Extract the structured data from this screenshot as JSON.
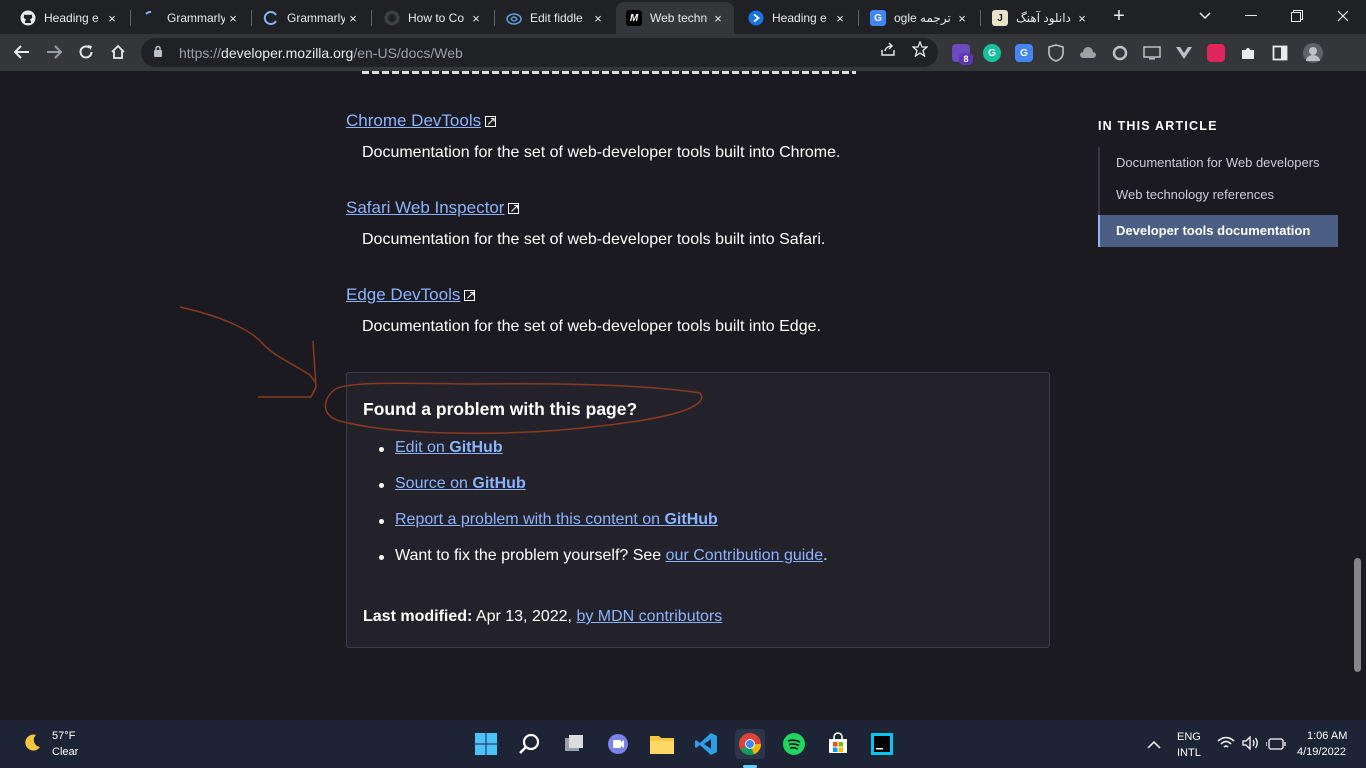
{
  "browser": {
    "tabs": [
      {
        "title": "Heading e",
        "icon": "github-icon"
      },
      {
        "title": "Grammarly",
        "icon": "loading-icon"
      },
      {
        "title": "Grammarly",
        "icon": "loading-icon"
      },
      {
        "title": "How to Co",
        "icon": "github-icon"
      },
      {
        "title": "Edit fiddle",
        "icon": "jsfiddle-icon"
      },
      {
        "title": "Web techn",
        "icon": "mdn-icon"
      },
      {
        "title": "Heading e",
        "icon": "blue-circle-icon"
      },
      {
        "title": "ogle ترجمه",
        "icon": "google-translate-icon"
      },
      {
        "title": "دانلود آهنگ",
        "icon": "site-icon"
      }
    ],
    "close_glyph": "×",
    "new_tab_glyph": "+",
    "url_host": "developer.mozilla.org",
    "url_prefix": "https://",
    "url_path": "/en-US/docs/Web",
    "ext_badge": "8"
  },
  "page": {
    "devtools": [
      {
        "name": "Chrome DevTools",
        "desc": "Documentation for the set of web-developer tools built into Chrome."
      },
      {
        "name": "Safari Web Inspector",
        "desc": "Documentation for the set of web-developer tools built into Safari."
      },
      {
        "name": "Edge DevTools",
        "desc": "Documentation for the set of web-developer tools built into Edge."
      }
    ],
    "toc_title": "IN THIS ARTICLE",
    "toc": [
      {
        "label": "Documentation for Web developers"
      },
      {
        "label": "Web technology references"
      },
      {
        "label": "Developer tools documentation"
      }
    ],
    "found": {
      "title": "Found a problem with this page?",
      "edit_prefix": "Edit on ",
      "source_prefix": "Source on ",
      "report_prefix": "Report a problem with this content on ",
      "github": "GitHub",
      "fix_text": "Want to fix the problem yourself? See ",
      "guide": "our Contribution guide",
      "guide_end": ".",
      "last_modified_label": "Last modified:",
      "last_modified_date": "Apr 13, 2022,",
      "contributors": "by MDN contributors"
    }
  },
  "taskbar": {
    "weather_temp": "57°F",
    "weather_desc": "Clear",
    "lang_1": "ENG",
    "lang_2": "INTL",
    "time": "1:06 AM",
    "date": "4/19/2022"
  },
  "colors": {
    "link": "#8cb4ff",
    "annotation": "#8b3a1f"
  }
}
